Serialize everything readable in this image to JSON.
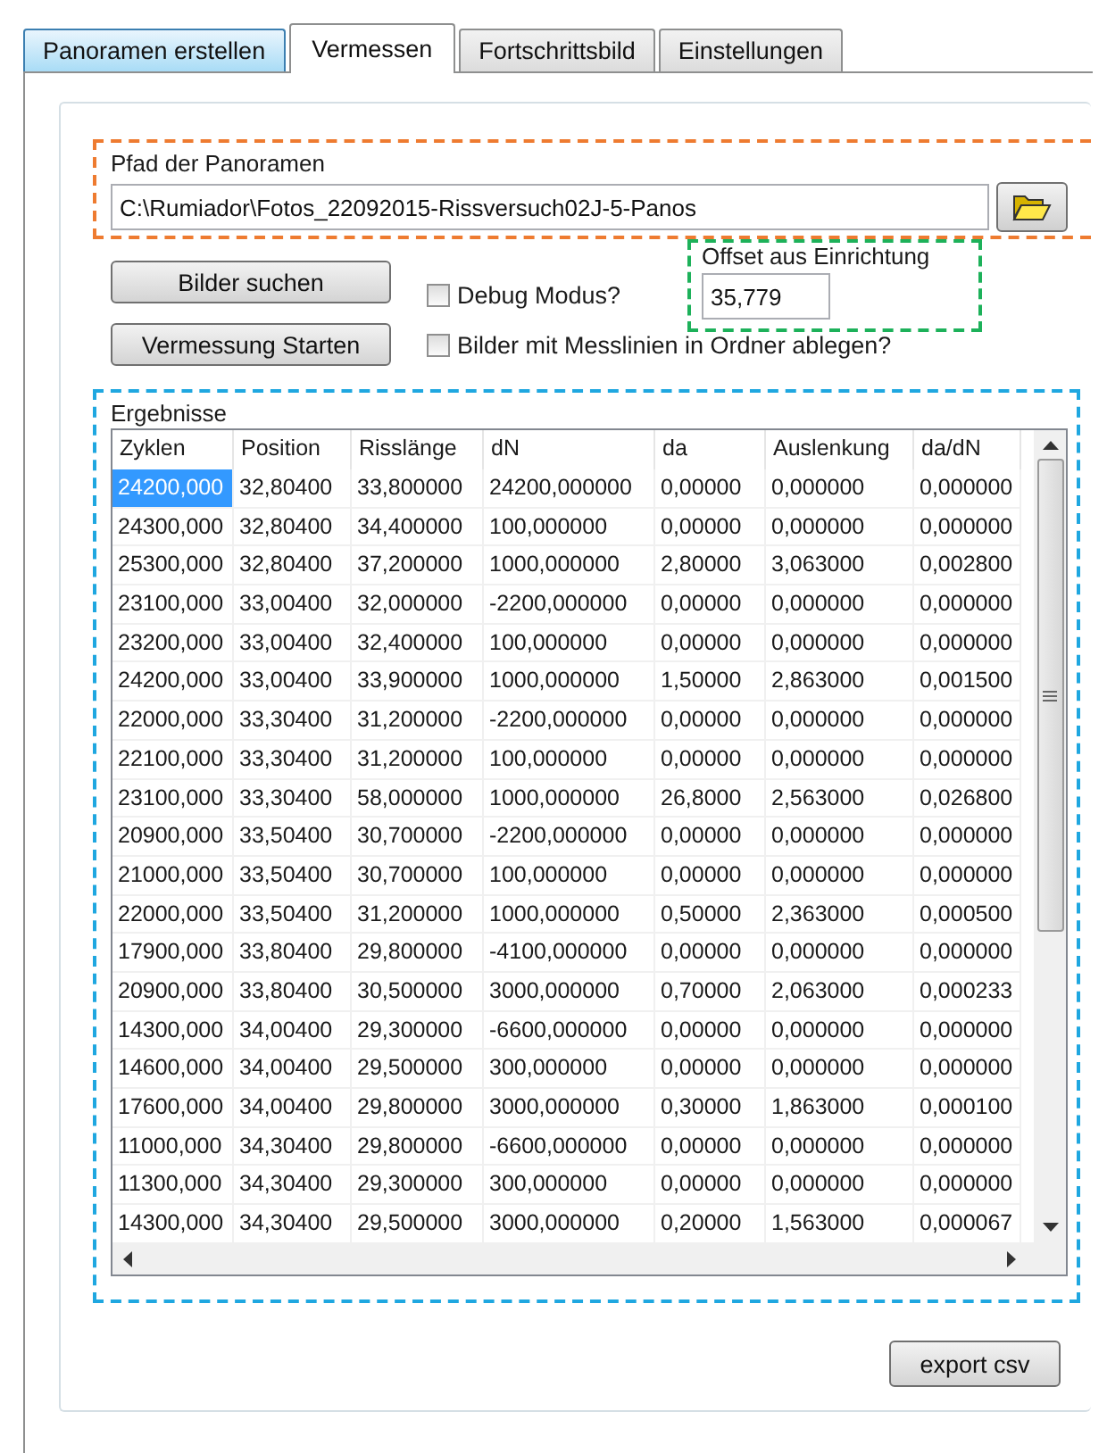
{
  "tabs": [
    {
      "label": "Panoramen erstellen",
      "selected": false,
      "highlighted": true
    },
    {
      "label": "Vermessen",
      "selected": true,
      "highlighted": false
    },
    {
      "label": "Fortschrittsbild",
      "selected": false,
      "highlighted": false
    },
    {
      "label": "Einstellungen",
      "selected": false,
      "highlighted": false
    }
  ],
  "path_group": {
    "label": "Pfad der Panoramen",
    "value": "C:\\Rumiador\\Fotos_22092015-Rissversuch02J-5-Panos"
  },
  "buttons": [
    "Bilder suchen",
    "Vermessung Starten"
  ],
  "checkboxes": [
    {
      "label": "Debug Modus?",
      "checked": false
    },
    {
      "label": "Bilder mit Messlinien in Ordner ablegen?",
      "checked": false
    }
  ],
  "offset": {
    "label": "Offset aus Einrichtung",
    "value": "35,779"
  },
  "results": {
    "label": "Ergebnisse",
    "columns": [
      "Zyklen",
      "Position",
      "Risslänge",
      "dN",
      "da",
      "Auslenkung",
      "da/dN"
    ],
    "rows": [
      {
        "selected": true,
        "cells": [
          "24200,000",
          "32,80400",
          "33,800000",
          "24200,000000",
          "0,00000",
          "0,000000",
          "0,000000"
        ]
      },
      {
        "selected": false,
        "cells": [
          "24300,000",
          "32,80400",
          "34,400000",
          "100,000000",
          "0,00000",
          "0,000000",
          "0,000000"
        ]
      },
      {
        "selected": false,
        "cells": [
          "25300,000",
          "32,80400",
          "37,200000",
          "1000,000000",
          "2,80000",
          "3,063000",
          "0,002800"
        ]
      },
      {
        "selected": false,
        "cells": [
          "23100,000",
          "33,00400",
          "32,000000",
          "-2200,000000",
          "0,00000",
          "0,000000",
          "0,000000"
        ]
      },
      {
        "selected": false,
        "cells": [
          "23200,000",
          "33,00400",
          "32,400000",
          "100,000000",
          "0,00000",
          "0,000000",
          "0,000000"
        ]
      },
      {
        "selected": false,
        "cells": [
          "24200,000",
          "33,00400",
          "33,900000",
          "1000,000000",
          "1,50000",
          "2,863000",
          "0,001500"
        ]
      },
      {
        "selected": false,
        "cells": [
          "22000,000",
          "33,30400",
          "31,200000",
          "-2200,000000",
          "0,00000",
          "0,000000",
          "0,000000"
        ]
      },
      {
        "selected": false,
        "cells": [
          "22100,000",
          "33,30400",
          "31,200000",
          "100,000000",
          "0,00000",
          "0,000000",
          "0,000000"
        ]
      },
      {
        "selected": false,
        "cells": [
          "23100,000",
          "33,30400",
          "58,000000",
          "1000,000000",
          "26,8000",
          "2,563000",
          "0,026800"
        ]
      },
      {
        "selected": false,
        "cells": [
          "20900,000",
          "33,50400",
          "30,700000",
          "-2200,000000",
          "0,00000",
          "0,000000",
          "0,000000"
        ]
      },
      {
        "selected": false,
        "cells": [
          "21000,000",
          "33,50400",
          "30,700000",
          "100,000000",
          "0,00000",
          "0,000000",
          "0,000000"
        ]
      },
      {
        "selected": false,
        "cells": [
          "22000,000",
          "33,50400",
          "31,200000",
          "1000,000000",
          "0,50000",
          "2,363000",
          "0,000500"
        ]
      },
      {
        "selected": false,
        "cells": [
          "17900,000",
          "33,80400",
          "29,800000",
          "-4100,000000",
          "0,00000",
          "0,000000",
          "0,000000"
        ]
      },
      {
        "selected": false,
        "cells": [
          "20900,000",
          "33,80400",
          "30,500000",
          "3000,000000",
          "0,70000",
          "2,063000",
          "0,000233"
        ]
      },
      {
        "selected": false,
        "cells": [
          "14300,000",
          "34,00400",
          "29,300000",
          "-6600,000000",
          "0,00000",
          "0,000000",
          "0,000000"
        ]
      },
      {
        "selected": false,
        "cells": [
          "14600,000",
          "34,00400",
          "29,500000",
          "300,000000",
          "0,00000",
          "0,000000",
          "0,000000"
        ]
      },
      {
        "selected": false,
        "cells": [
          "17600,000",
          "34,00400",
          "29,800000",
          "3000,000000",
          "0,30000",
          "1,863000",
          "0,000100"
        ]
      },
      {
        "selected": false,
        "cells": [
          "11000,000",
          "34,30400",
          "29,800000",
          "-6600,000000",
          "0,00000",
          "0,000000",
          "0,000000"
        ]
      },
      {
        "selected": false,
        "cells": [
          "11300,000",
          "34,30400",
          "29,300000",
          "300,000000",
          "0,00000",
          "0,000000",
          "0,000000"
        ]
      },
      {
        "selected": false,
        "cells": [
          "14300,000",
          "34,30400",
          "29,500000",
          "3000,000000",
          "0,20000",
          "1,563000",
          "0,000067"
        ]
      }
    ]
  },
  "export_button": "export csv"
}
